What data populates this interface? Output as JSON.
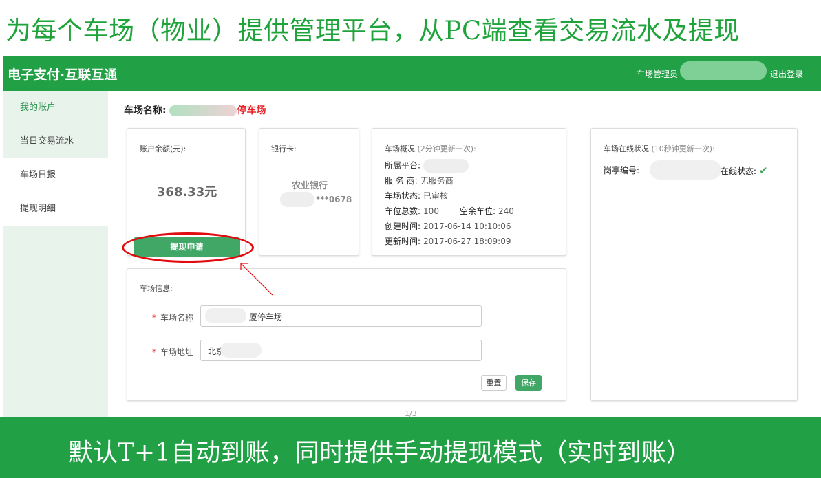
{
  "caption_top": "为每个车场（物业）提供管理平台，从PC端查看交易流水及提现",
  "caption_bottom": "默认T+1自动到账，同时提供手动提现模式（实时到账）",
  "header": {
    "brand": "电子支付·互联互通",
    "role_label": "车场管理员",
    "logout": "退出登录"
  },
  "sidebar": {
    "items": [
      {
        "label": "我的账户"
      },
      {
        "label": "当日交易流水"
      },
      {
        "label": "车场日报"
      },
      {
        "label": "提现明细"
      }
    ]
  },
  "lot": {
    "title_label": "车场名称:",
    "title_suffix": "停车场"
  },
  "account": {
    "label": "账户余额(元):",
    "balance": "368.33元",
    "withdraw_button": "提现申请"
  },
  "bank": {
    "label": "银行卡:",
    "bank_name": "农业银行",
    "card_suffix": "***0678"
  },
  "overview": {
    "label": "车场概况",
    "note": "(2分钟更新一次):",
    "platform_key": "所属平台:",
    "provider_key": "服 务 商:",
    "provider_val": "无服务商",
    "status_key": "车场状态:",
    "status_val": "已审核",
    "total_key": "车位总数:",
    "total_val": "100",
    "free_key": "空余车位:",
    "free_val": "240",
    "created_key": "创建时间:",
    "created_val": "2017-06-14 10:10:06",
    "updated_key": "更新时间:",
    "updated_val": "2017-06-27 18:09:09"
  },
  "online": {
    "label": "车场在线状况",
    "note": "(10秒钟更新一次):",
    "booth_key": "岗亭编号:",
    "status_key": "在线状态:",
    "status_icon": "check-icon"
  },
  "info": {
    "label": "车场信息:",
    "name_label": "车场名称",
    "name_value": "厦停车场",
    "addr_label": "车场地址",
    "addr_value": "北京",
    "reset": "重置",
    "save": "保存"
  },
  "page_indicator": "1/3",
  "colors": {
    "brand_green": "#21a046",
    "button_green": "#41a766",
    "highlight_red": "#e00a0f"
  }
}
